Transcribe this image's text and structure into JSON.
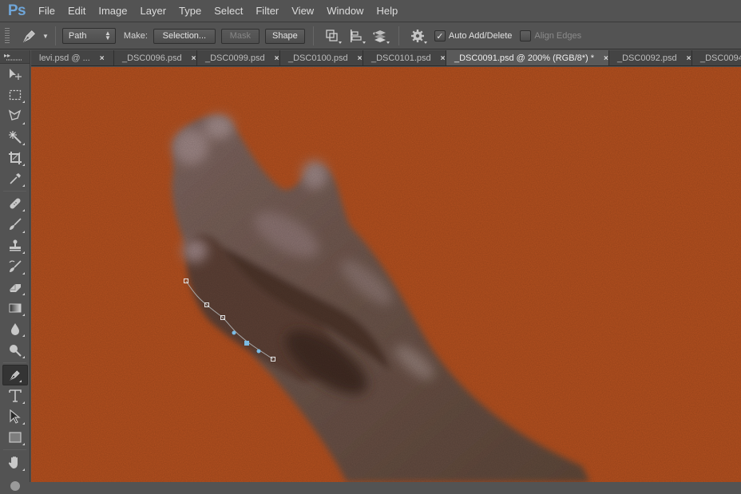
{
  "app": {
    "logo": "Ps"
  },
  "menu": [
    "File",
    "Edit",
    "Image",
    "Layer",
    "Type",
    "Select",
    "Filter",
    "View",
    "Window",
    "Help"
  ],
  "options": {
    "tool_icon": "pen-icon",
    "mode_select": "Path",
    "make_label": "Make:",
    "selection_button": "Selection...",
    "mask_button": "Mask",
    "shape_button": "Shape",
    "path_operations_icon": "path-operations-icon",
    "path_alignment_icon": "path-alignment-icon",
    "path_arrangement_icon": "path-arrangement-icon",
    "settings_icon": "gear-icon",
    "auto_add_delete": {
      "label": "Auto Add/Delete",
      "checked": true
    },
    "align_edges": {
      "label": "Align Edges",
      "checked": false
    }
  },
  "toolbar": {
    "collapse_label": "▸▸",
    "tools": [
      {
        "name": "move-tool",
        "icon": "move-icon"
      },
      {
        "name": "marquee-tool",
        "icon": "rectangular-marquee-icon"
      },
      {
        "name": "lasso-tool",
        "icon": "polygonal-lasso-icon"
      },
      {
        "name": "magic-wand-tool",
        "icon": "magic-wand-icon"
      },
      {
        "name": "crop-tool",
        "icon": "crop-icon"
      },
      {
        "name": "eyedropper-tool",
        "icon": "eyedropper-icon"
      },
      {
        "name": "healing-brush-tool",
        "icon": "bandage-icon"
      },
      {
        "name": "brush-tool",
        "icon": "brush-icon"
      },
      {
        "name": "clone-stamp-tool",
        "icon": "stamp-icon"
      },
      {
        "name": "history-brush-tool",
        "icon": "history-brush-icon"
      },
      {
        "name": "eraser-tool",
        "icon": "eraser-icon"
      },
      {
        "name": "gradient-tool",
        "icon": "gradient-icon"
      },
      {
        "name": "blur-tool",
        "icon": "drop-icon"
      },
      {
        "name": "dodge-tool",
        "icon": "dodge-icon"
      },
      {
        "name": "pen-tool",
        "icon": "pen-icon",
        "active": true
      },
      {
        "name": "type-tool",
        "icon": "type-icon"
      },
      {
        "name": "path-selection-tool",
        "icon": "arrow-icon"
      },
      {
        "name": "rectangle-tool",
        "icon": "rectangle-icon"
      },
      {
        "name": "hand-tool",
        "icon": "hand-icon"
      },
      {
        "name": "zoom-tool",
        "icon": "zoom-icon"
      }
    ]
  },
  "tabs": [
    {
      "label": "levi.psd @ ...",
      "active": false
    },
    {
      "label": "_DSC0096.psd",
      "active": false
    },
    {
      "label": "_DSC0099.psd",
      "active": false
    },
    {
      "label": "_DSC0100.psd",
      "active": false
    },
    {
      "label": "_DSC0101.psd",
      "active": false
    },
    {
      "label": "_DSC0091.psd @ 200% (RGB/8*) *",
      "active": true
    },
    {
      "label": "_DSC0092.psd",
      "active": false
    },
    {
      "label": "_DSC0094",
      "active": false
    }
  ],
  "tab_close_glyph": "×",
  "canvas": {
    "background_color": "#b4501f",
    "subject": "hand",
    "path_anchor_count": 7
  }
}
